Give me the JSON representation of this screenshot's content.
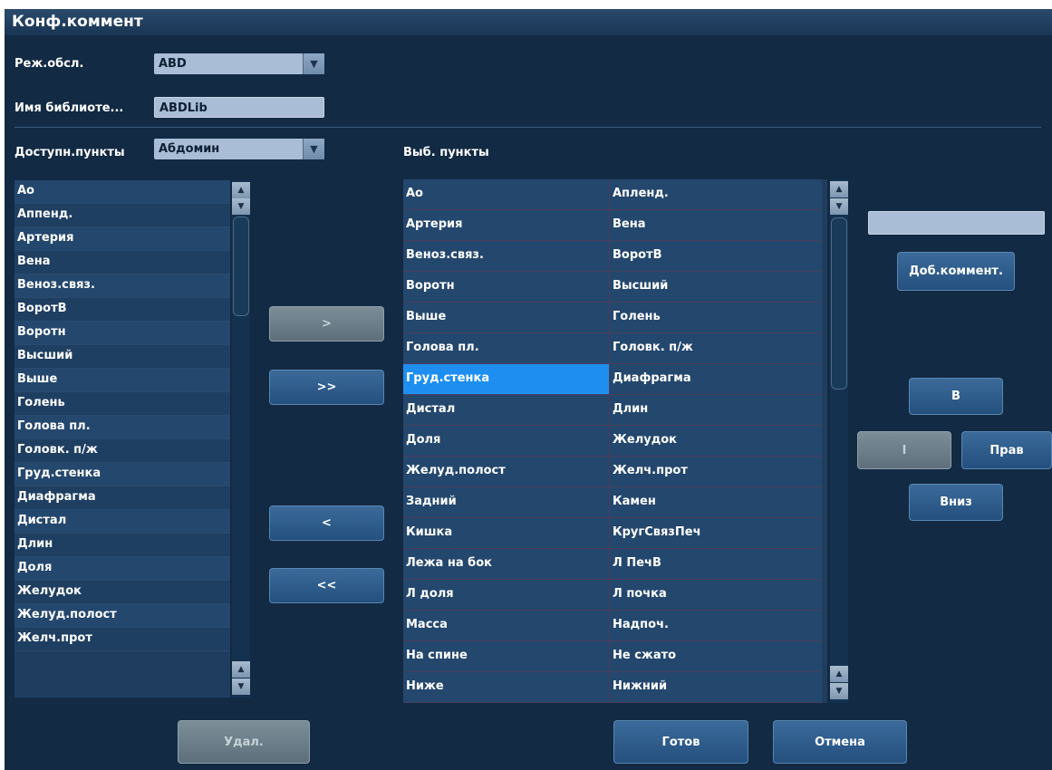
{
  "title": "Конф.коммент",
  "mode": {
    "label": "Реж.обсл.",
    "value": "ABD"
  },
  "library": {
    "label": "Имя библиоте...",
    "value": "ABDLib"
  },
  "available": {
    "label": "Доступн.пункты",
    "category": "Абдомин",
    "items": [
      "Ао",
      "Аппенд.",
      "Артерия",
      "Вена",
      "Веноз.связ.",
      "ВоротВ",
      "Воротн",
      "Высший",
      "Выше",
      "Голень",
      "Голова пл.",
      "Головк. п/ж",
      "Груд.стенка",
      "Диафрагма",
      "Дистал",
      "Длин",
      "Доля",
      "Желудок",
      "Желуд.полост",
      "Желч.прот"
    ]
  },
  "selected": {
    "label": "Выб. пункты",
    "rows": [
      [
        "Ао",
        "Апленд."
      ],
      [
        "Артерия",
        "Вена"
      ],
      [
        "Веноз.связ.",
        "ВоротВ"
      ],
      [
        "Воротн",
        "Высший"
      ],
      [
        "Выше",
        "Голень"
      ],
      [
        "Голова пл.",
        "Головк. п/ж"
      ],
      [
        "Груд.стенка",
        "Диафрагма"
      ],
      [
        "Дистал",
        "Длин"
      ],
      [
        "Доля",
        "Желудок"
      ],
      [
        "Желуд.полост",
        "Желч.прот"
      ],
      [
        "Задний",
        "Камен"
      ],
      [
        "Кишка",
        "КругСвязПеч"
      ],
      [
        "Лежа на бок",
        "Л ПечВ"
      ],
      [
        "Л доля",
        "Л почка"
      ],
      [
        "Масса",
        "Надпоч."
      ],
      [
        "На спине",
        "Не сжато"
      ],
      [
        "Ниже",
        "Нижний"
      ]
    ]
  },
  "buttons": {
    "add_one": ">",
    "add_all": ">>",
    "remove_one": "<",
    "remove_all": "<<",
    "delete": "Удал.",
    "add_comment": "Доб.коммент.",
    "up": "В",
    "left": "l",
    "right": "Прав",
    "down": "Вниз",
    "done": "Готов",
    "cancel": "Отмена"
  },
  "comment_input": {
    "value": ""
  },
  "colors": {
    "background": "#122a43",
    "selection": "#1e8ff0",
    "list_row": "#24476d"
  }
}
